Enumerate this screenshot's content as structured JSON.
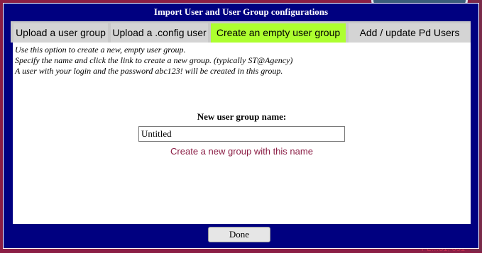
{
  "dialog": {
    "title": "Import User and User Group configurations"
  },
  "tabs": [
    {
      "label": "Upload a user group",
      "active": false
    },
    {
      "label": "Upload a .config user",
      "active": false
    },
    {
      "label": "Create an empty user group",
      "active": true
    },
    {
      "label": "Add / update Pd Users",
      "active": false
    }
  ],
  "content": {
    "info_lines": [
      "Use this option to create a new, empty user group.",
      "Specify the name and click the link to create a new group. (typically ST@Agency)",
      "A user with your login and the password abc123! will be created in this group."
    ],
    "form_label": "New user group name:",
    "name_value": "Untitled",
    "create_link": "Create a new group with this name"
  },
  "footer": {
    "done_label": "Done"
  },
  "background": {
    "bottom_text": "PL…31, 051"
  },
  "colors": {
    "dialog_bg": "#000080",
    "active_tab": "#adff2f",
    "link": "#8b1e45"
  }
}
